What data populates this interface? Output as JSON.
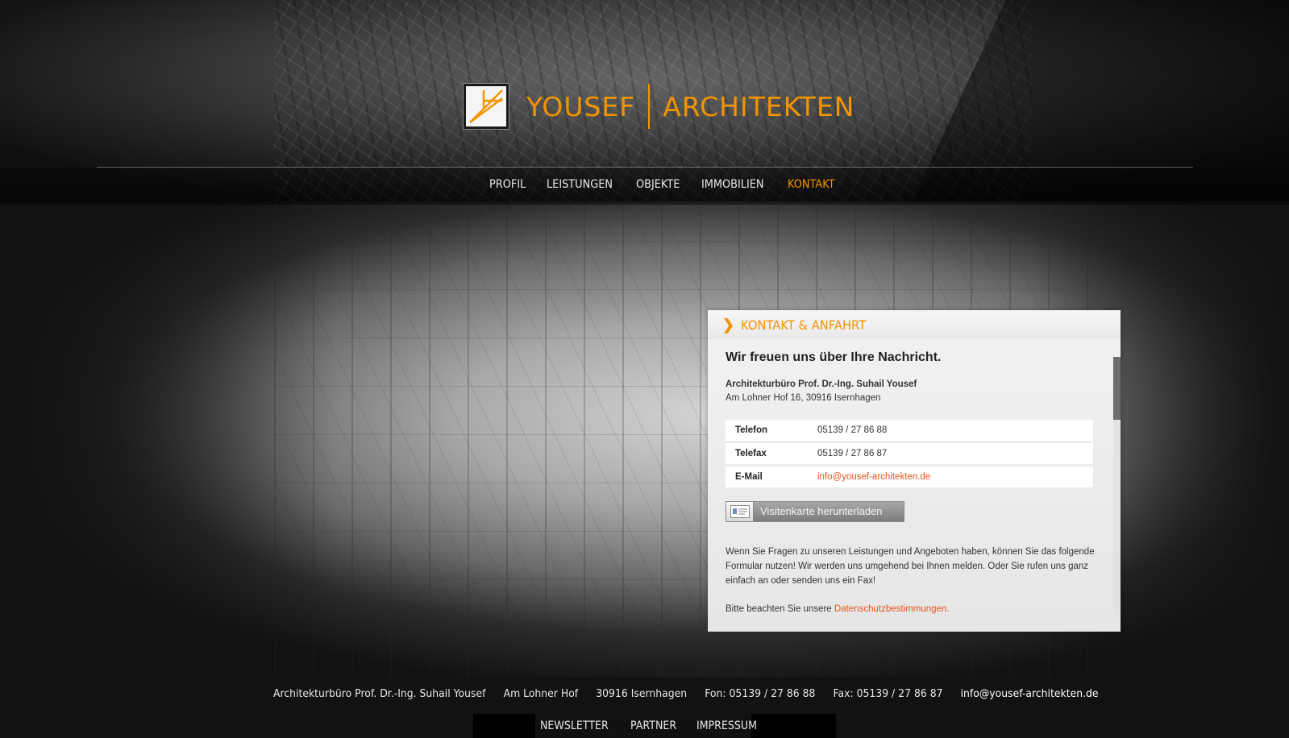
{
  "brand": {
    "name_left": "YOUSEF",
    "name_right": "ARCHITEKTEN",
    "accent_color": "#f29400"
  },
  "nav": {
    "items": [
      {
        "label": "PROFIL"
      },
      {
        "label": "LEISTUNGEN"
      },
      {
        "label": "OBJEKTE"
      },
      {
        "label": "IMMOBILIEN"
      },
      {
        "label": "KONTAKT",
        "active": true
      }
    ]
  },
  "panel": {
    "title": "KONTAKT & ANFAHRT",
    "headline": "Wir freuen uns über Ihre Nachricht.",
    "company": "Architekturbüro Prof. Dr.-Ing. Suhail Yousef",
    "address": "Am Lohner Hof 16, 30916 Isernhagen",
    "contacts": [
      {
        "label": "Telefon",
        "value": "05139 / 27 86 88"
      },
      {
        "label": "Telefax",
        "value": "05139 / 27 86 87"
      },
      {
        "label": "E-Mail",
        "value": "info@yousef-architekten.de"
      }
    ],
    "vcard_button": "Visitenkarte herunterladen",
    "paragraph": "Wenn Sie Fragen zu unseren Leistungen und Angeboten haben, können Sie das folgende Formular nutzen! Wir werden uns umgehend bei Ihnen melden. Oder Sie rufen uns ganz einfach an oder senden uns ein Fax!",
    "privacy_prefix": "Bitte beachten Sie unsere",
    "privacy_link": "Datenschutzbestimmungen."
  },
  "footer": {
    "company": "Architekturbüro Prof. Dr.-Ing. Suhail Yousef",
    "street": "Am Lohner Hof",
    "city": "30916 Isernhagen",
    "fon": "Fon:  05139 / 27 86 88",
    "fax": "Fax:  05139 / 27 86 87",
    "email": "info@yousef-architekten.de",
    "links": [
      {
        "label": "NEWSLETTER"
      },
      {
        "label": "PARTNER"
      },
      {
        "label": "IMPRESSUM"
      }
    ]
  }
}
